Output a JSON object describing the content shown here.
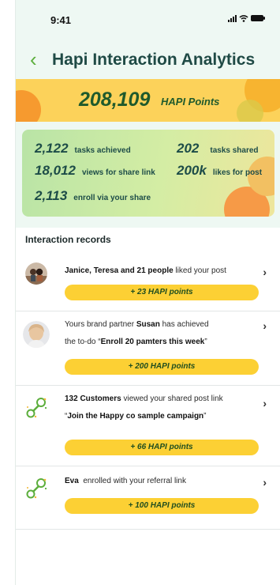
{
  "status": {
    "time": "9:41"
  },
  "header": {
    "back_icon": "chevron-left-icon",
    "title": "Hapi Interaction Analytics"
  },
  "points": {
    "value": "208,109",
    "unit": "HAPI Points"
  },
  "stats": [
    {
      "value": "2,122",
      "label": "tasks achieved"
    },
    {
      "value": "202",
      "label": "tasks shared"
    },
    {
      "value": "18,012",
      "label": "views for share link"
    },
    {
      "value": "200k",
      "label": "likes for post"
    },
    {
      "value": "2,113",
      "label": "enroll via your share"
    }
  ],
  "records": {
    "heading": "Interaction records",
    "items": [
      {
        "icon": "avatar-couple",
        "names": "Janice, Teresa and 21 people",
        "text_after": " liked your post",
        "reward": "+ 23 HAPI points"
      },
      {
        "icon": "avatar-woman",
        "text_before": "Yours brand partner ",
        "partner": "Susan",
        "text_after": " has achieved",
        "line2_before": "the to-do “",
        "task": "Enroll 20 pamters this week",
        "line2_after": "”",
        "reward": "+ 200 HAPI points"
      },
      {
        "icon": "share-link-icon",
        "count": "132 Customers",
        "text_after": " viewed your shared post link",
        "line2_before": "“",
        "campaign": "Join the Happy co sample campaign",
        "line2_after": "”",
        "reward": "+ 66 HAPI points"
      },
      {
        "icon": "share-link-icon",
        "name": "Eva",
        "text_after": "  enrolled with your referral link",
        "reward": "+ 100 HAPI points"
      }
    ]
  },
  "colors": {
    "accent_green": "#5cae3c",
    "title_dark": "#1f4a45",
    "banner_yellow": "#fcd25a",
    "pill_yellow": "#fcd034",
    "orange": "#f69a2f"
  }
}
